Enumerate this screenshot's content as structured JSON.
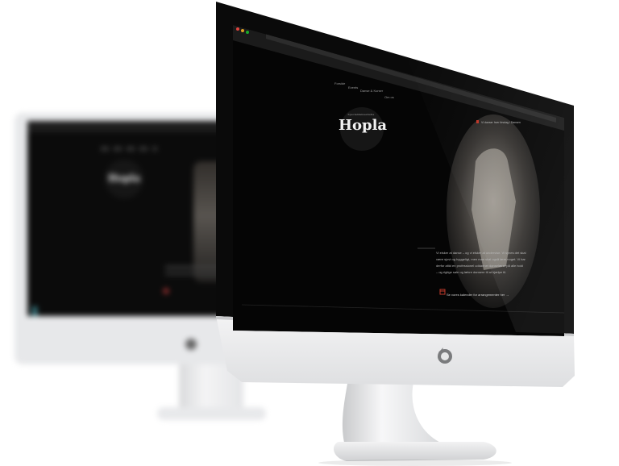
{
  "website": {
    "nav": [
      "Forside",
      "Events",
      "Danse & Kurser",
      "Om os"
    ],
    "tagline": "Specialdansestudie",
    "brand": "Hopla",
    "topbar_text": "Vi danser hver tirsdag i Dansen",
    "body_lines": [
      "Vi elsker at danse – og vi elsker at undervise. Vi synes det skal",
      "være sjovt og hyggeligt, men man skal også lære noget. Vi har",
      "derfor altid en professionel uddannet danselærer på alle hold",
      "– og rigtige sale og lækre dansere til at hjælpe til."
    ],
    "calendar_link": "Se vores kalender for arrangementer her →"
  },
  "back_monitor": {
    "brand": "Hopla"
  },
  "colors": {
    "screen": "#050505",
    "shell": "#eceded",
    "accent_red": "#c0392b",
    "teal": "#3a7d86"
  },
  "icons": {
    "apple_logo": "apple-logo-icon",
    "calendar": "calendar-icon",
    "traffic_lights": [
      "close-icon",
      "minimize-icon",
      "maximize-icon"
    ]
  }
}
